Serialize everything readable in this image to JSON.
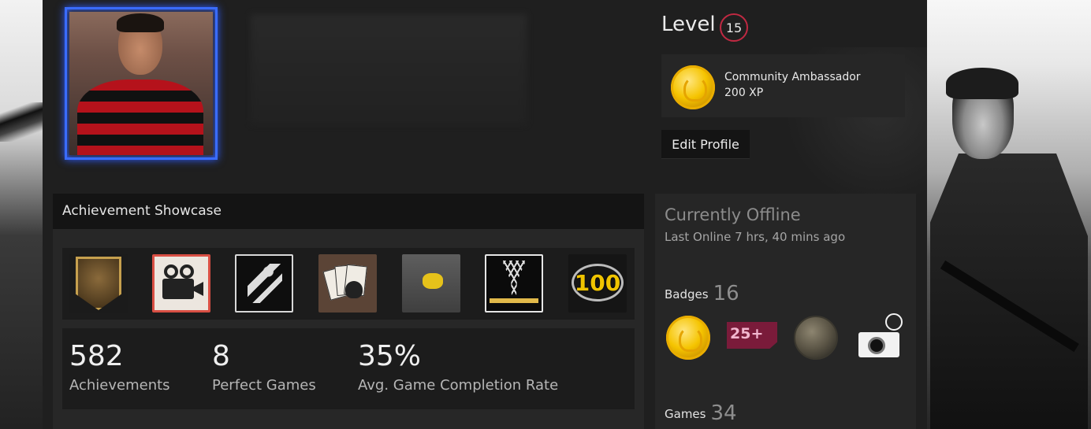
{
  "profile": {
    "level_label": "Level",
    "level": "15",
    "favorite_badge": {
      "name": "Community Ambassador",
      "xp": "200 XP",
      "icon": "gold-coin-icon"
    },
    "edit_button": "Edit Profile"
  },
  "showcase": {
    "title": "Achievement Showcase",
    "icons": [
      "shield-achievement-icon",
      "film-camera-achievement-icon",
      "fighter-achievement-icon",
      "skull-cards-achievement-icon",
      "yellow-figure-achievement-icon",
      "dead-tree-achievement-icon",
      "100-achievement-icon"
    ],
    "badge_100_text": "100",
    "stats": [
      {
        "value": "582",
        "label": "Achievements"
      },
      {
        "value": "8",
        "label": "Perfect Games"
      },
      {
        "value": "35%",
        "label": "Avg. Game Completion Rate"
      }
    ]
  },
  "sidebar": {
    "status": "Currently Offline",
    "last_online": "Last Online 7 hrs, 40 mins ago",
    "badges_label": "Badges",
    "badges_count": "16",
    "badge_25_text": "25+",
    "games_label": "Games",
    "games_count": "34"
  },
  "colors": {
    "avatar_frame": "#3a6cff",
    "level_ring": "#c02942",
    "panel": "#1f1f1f"
  }
}
